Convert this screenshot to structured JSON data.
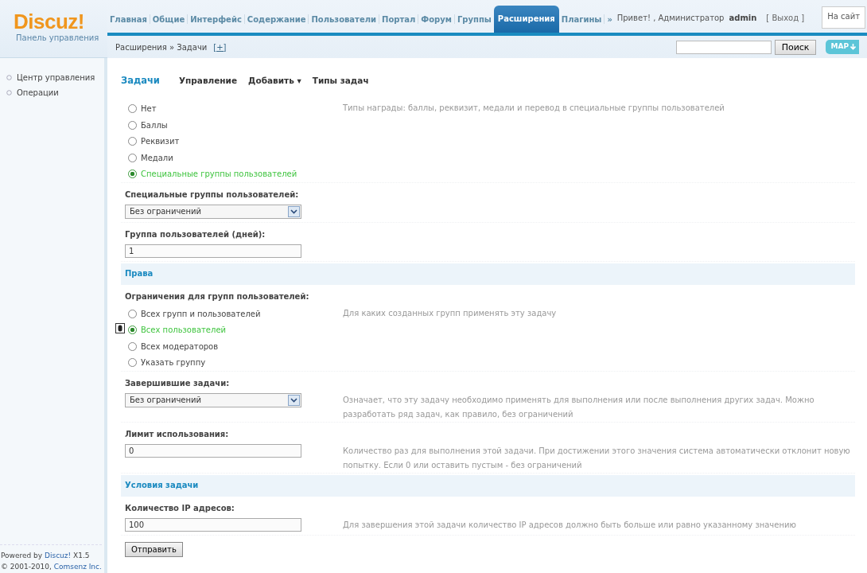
{
  "logo": {
    "name": "Discuz!",
    "subtitle": "Панель управления"
  },
  "nav": [
    {
      "label": "Главная",
      "selected": false
    },
    {
      "label": "Общие",
      "selected": false
    },
    {
      "label": "Интерфейс",
      "selected": false
    },
    {
      "label": "Содержание",
      "selected": false
    },
    {
      "label": "Пользователи",
      "selected": false
    },
    {
      "label": "Портал",
      "selected": false
    },
    {
      "label": "Форум",
      "selected": false
    },
    {
      "label": "Группы",
      "selected": false
    },
    {
      "label": "Расширения",
      "selected": true
    },
    {
      "label": "Плагины",
      "selected": false
    },
    {
      "label": "»",
      "selected": false
    }
  ],
  "user": {
    "greeting": "Привет! , Администратор",
    "username": "admin",
    "logout": "[ Выход ]",
    "site_button": "На сайт"
  },
  "breadcrumb": {
    "items": [
      "Расширения",
      "Задачи"
    ],
    "separator": "»",
    "add": "[+]"
  },
  "search": {
    "button": "Поиск",
    "map_button": "MAP"
  },
  "sidebar": {
    "items": [
      {
        "label": "Центр управления"
      },
      {
        "label": "Операции"
      }
    ]
  },
  "subtabs": [
    {
      "label": "Задачи",
      "selected": true
    },
    {
      "label": "Управление",
      "selected": false
    },
    {
      "label": "Добавить",
      "selected": false,
      "caret": "▾"
    },
    {
      "label": "Типы задач",
      "selected": false
    }
  ],
  "form": [
    {
      "kind": "radio",
      "options": [
        {
          "label": "Нет",
          "selected": false
        },
        {
          "label": "Баллы",
          "selected": false
        },
        {
          "label": "Реквизит",
          "selected": false
        },
        {
          "label": "Медали",
          "selected": false
        },
        {
          "label": "Специальные группы пользователей",
          "selected": true
        }
      ],
      "hint": "Типы награды: баллы, реквизит, медали и перевод в специальные группы пользователей"
    },
    {
      "kind": "select",
      "label": "Специальные группы пользователей:",
      "value": "Без ограничений"
    },
    {
      "kind": "text",
      "label": "Группа пользователей (дней):",
      "value": "1"
    },
    {
      "kind": "header",
      "label": "Права"
    },
    {
      "kind": "radio",
      "label": "Ограничения для групп пользователей:",
      "options": [
        {
          "label": "Всех групп и пользователей",
          "selected": false
        },
        {
          "label": "Всех пользователей",
          "selected": true
        },
        {
          "label": "Всех модераторов",
          "selected": false
        },
        {
          "label": "Указать группу",
          "selected": false
        }
      ],
      "hint": "Для каких созданных групп применять эту задачу"
    },
    {
      "kind": "select",
      "label": "Завершившие задачи:",
      "value": "Без ограничений",
      "hint": "Означает, что эту задачу необходимо применять для выполнения или после выполнения других задач. Можно разработать ряд задач, как правило, без ограничений"
    },
    {
      "kind": "text",
      "label": "Лимит использования:",
      "value": "0",
      "hint": "Количество раз для выполнения этой задачи. При достижении этого значения система автоматически отклонит новую попытку. Если 0 или оставить пустым - без ограничений"
    },
    {
      "kind": "header",
      "label": "Условия задачи"
    },
    {
      "kind": "text",
      "label": "Количество IP адресов:",
      "value": "100",
      "hint": "Для завершения этой задачи количество IP адресов должно быть больше или равно указанному значению"
    },
    {
      "kind": "submit",
      "label": "Отправить"
    }
  ],
  "footer": [
    {
      "before": "Powered by ",
      "link": "Discuz!",
      "after": " X1.5"
    },
    {
      "before": "© 2001-2010, ",
      "link": "Comsenz Inc."
    }
  ]
}
